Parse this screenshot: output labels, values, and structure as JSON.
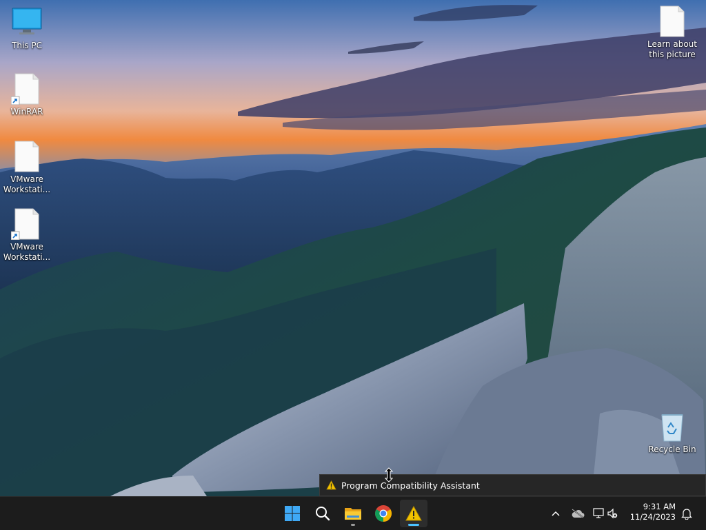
{
  "desktop": {
    "icons": [
      {
        "label": "This PC",
        "icon": "monitor-icon"
      },
      {
        "label": "WinRAR",
        "icon": "file-shortcut-icon"
      },
      {
        "label": "VMware Workstati...",
        "icon": "file-icon"
      },
      {
        "label": "VMware Workstati...",
        "icon": "file-shortcut-icon"
      },
      {
        "label": "Learn about this picture",
        "icon": "file-icon"
      },
      {
        "label": "Recycle Bin",
        "icon": "recycle-bin-icon"
      }
    ]
  },
  "tooltip": {
    "title": "Program Compatibility Assistant",
    "icon": "warning-icon"
  },
  "taskbar": {
    "apps": [
      {
        "name": "Start",
        "icon": "windows-start-icon",
        "state": "idle"
      },
      {
        "name": "Search",
        "icon": "search-icon",
        "state": "idle"
      },
      {
        "name": "File Explorer",
        "icon": "folder-icon",
        "state": "running"
      },
      {
        "name": "Google Chrome",
        "icon": "chrome-icon",
        "state": "idle"
      },
      {
        "name": "Program Compatibility Assistant",
        "icon": "warning-icon",
        "state": "active"
      }
    ],
    "tray": {
      "icons": [
        "chevron-up-icon",
        "cloud-offline-icon",
        "network-icon",
        "volume-muted-icon",
        "notification-bell-icon"
      ],
      "time": "9:31 AM",
      "date": "11/24/2023"
    }
  },
  "colors": {
    "taskbar_bg": "#1c1c1c",
    "active_indicator": "#4cc2ff",
    "warning_yellow": "#f2c200"
  }
}
